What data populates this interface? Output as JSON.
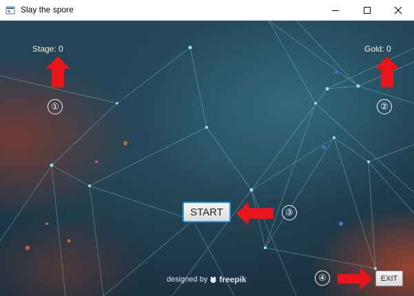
{
  "window": {
    "title": "Slay the spore",
    "controls": {
      "minimize_icon": "minimize-icon",
      "maximize_icon": "maximize-icon",
      "close_icon": "close-icon"
    }
  },
  "hud": {
    "stage_label": "Stage: 0",
    "gold_label": "Gold: 0"
  },
  "buttons": {
    "start_label": "START",
    "exit_label": "EXIT"
  },
  "callouts": [
    "①",
    "②",
    "③",
    "④"
  ],
  "credit": {
    "prefix": "designed by",
    "brand": "freepik",
    "logo_icon": "freepik-logo-icon"
  },
  "colors": {
    "arrow": "#e8161b",
    "start_border": "#2b95e0",
    "hud_text": "#ffffff"
  }
}
